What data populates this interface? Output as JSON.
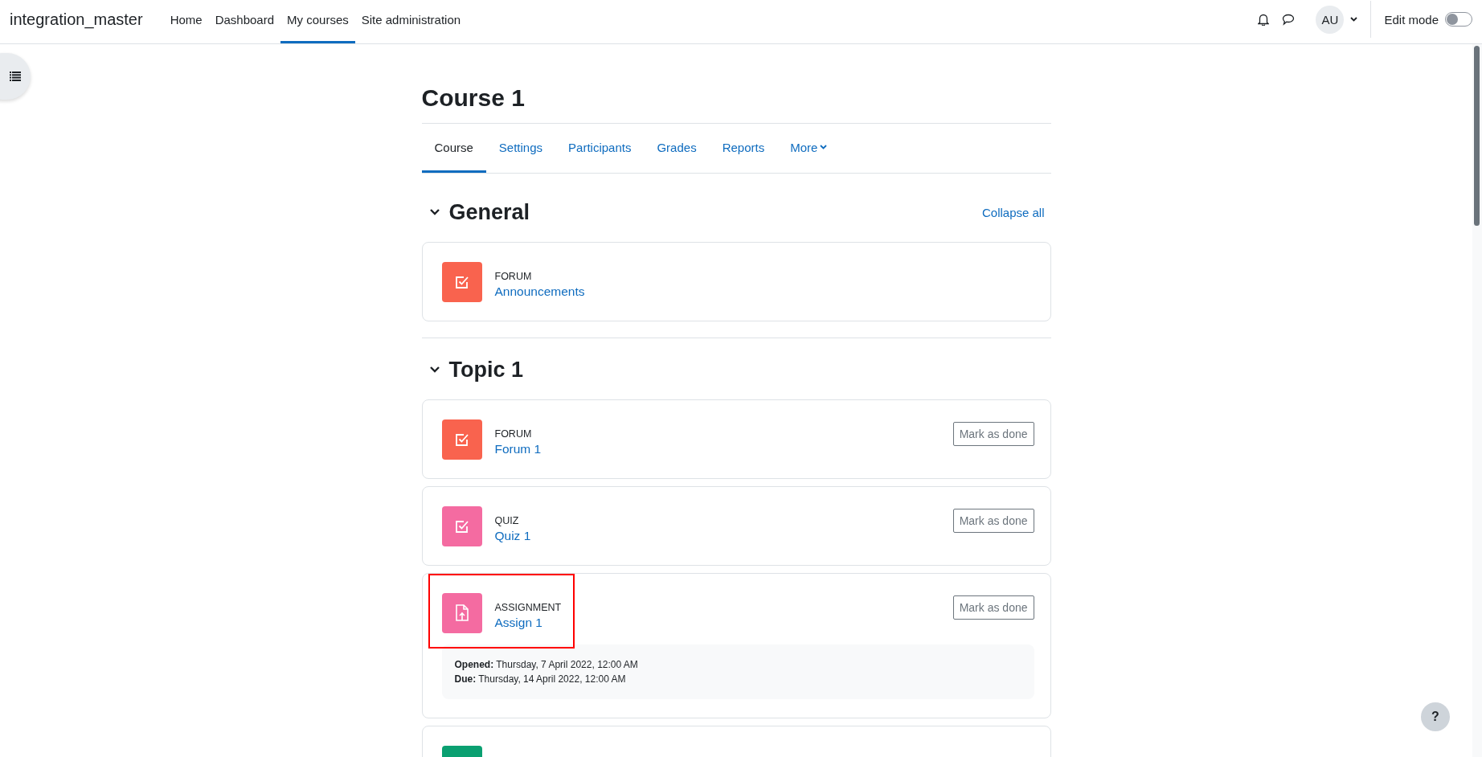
{
  "navbar": {
    "brand": "integration_master",
    "links": [
      {
        "label": "Home",
        "selected": false
      },
      {
        "label": "Dashboard",
        "selected": false
      },
      {
        "label": "My courses",
        "selected": true
      },
      {
        "label": "Site administration",
        "selected": false
      }
    ],
    "avatar": "AU",
    "edit_mode": {
      "label": "Edit mode",
      "on": false
    }
  },
  "course": {
    "title": "Course 1",
    "tabs": [
      {
        "label": "Course",
        "selected": true,
        "menu": false
      },
      {
        "label": "Settings",
        "selected": false,
        "menu": false
      },
      {
        "label": "Participants",
        "selected": false,
        "menu": false
      },
      {
        "label": "Grades",
        "selected": false,
        "menu": false
      },
      {
        "label": "Reports",
        "selected": false,
        "menu": false
      },
      {
        "label": "More",
        "selected": false,
        "menu": true
      }
    ],
    "collapse_all": "Collapse all",
    "sections": [
      {
        "title": "General",
        "expanded": true,
        "activities": [
          {
            "kind": "forum",
            "color": "#f9634e",
            "type": "FORUM",
            "name": "Announcements",
            "highlighted": false
          }
        ]
      },
      {
        "title": "Topic 1",
        "expanded": true,
        "activities": [
          {
            "kind": "forum",
            "color": "#f9634e",
            "type": "FORUM",
            "name": "Forum 1",
            "mark_done": "Mark as done",
            "highlighted": false
          },
          {
            "kind": "quiz",
            "color": "#f46ba1",
            "type": "QUIZ",
            "name": "Quiz 1",
            "mark_done": "Mark as done",
            "highlighted": false
          },
          {
            "kind": "assign",
            "color": "#f46ba1",
            "type": "ASSIGNMENT",
            "name": "Assign 1",
            "mark_done": "Mark as done",
            "highlighted": true,
            "dates": [
              {
                "label": "Opened:",
                "value": "Thursday, 7 April 2022, 12:00 AM"
              },
              {
                "label": "Due:",
                "value": "Thursday, 14 April 2022, 12:00 AM"
              }
            ]
          },
          {
            "kind": "choice",
            "color": "#0aa071",
            "highlighted": false
          }
        ]
      }
    ]
  },
  "help_button": "?"
}
